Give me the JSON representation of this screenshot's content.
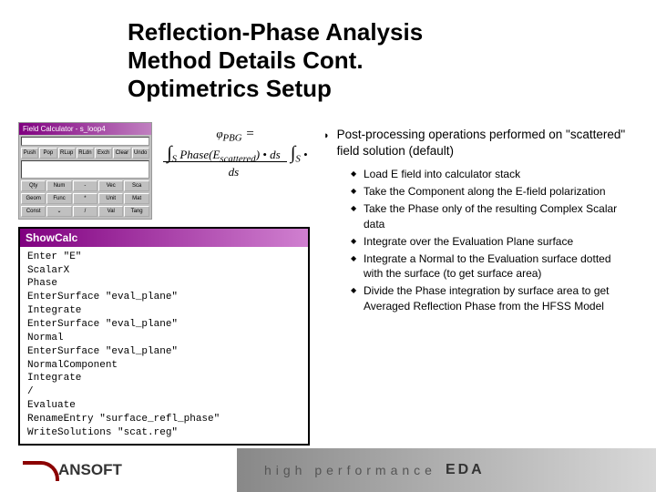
{
  "title_line1": "Reflection-Phase Analysis",
  "title_line2": "Method Details Cont.",
  "title_line3": "Optimetrics Setup",
  "calc_window": {
    "title": "Field Calculator - s_loop4"
  },
  "formula": {
    "label": "φ",
    "sub": "PBG",
    "eq": "=",
    "num_int": "∫",
    "num_sub": "S",
    "num_expr": "Phase(E",
    "num_expr_sub": "scattered",
    "num_expr2": ") • ds",
    "den_int": "∫",
    "den_sub": "S",
    "den_expr": "• ds"
  },
  "showcalc": {
    "title": "ShowCalc",
    "lines": [
      "Enter \"E\"",
      "ScalarX",
      "Phase",
      "EnterSurface \"eval_plane\"",
      "Integrate",
      "EnterSurface \"eval_plane\"",
      "Normal",
      "EnterSurface \"eval_plane\"",
      "NormalComponent",
      "Integrate",
      "/",
      "Evaluate",
      "RenameEntry \"surface_refl_phase\"",
      "WriteSolutions \"scat.reg\""
    ]
  },
  "main_point": "Post-processing operations performed on \"scattered\" field solution (default)",
  "sub_points": [
    "Load E field into calculator stack",
    "Take the Component along the E-field polarization",
    "Take the Phase only of the resulting Complex Scalar data",
    "Integrate over the Evaluation Plane surface",
    "Integrate a Normal to the Evaluation surface dotted with the surface (to get surface area)",
    "Divide the Phase integration by surface area to get Averaged Reflection Phase from the HFSS Model"
  ],
  "footer": {
    "logo": "ANSOFT",
    "tagline": "high performance",
    "tagline_bold": "EDA"
  },
  "calc_buttons_row1": [
    "Push",
    "Pop",
    "RLup",
    "RLdn",
    "Exch",
    "Clear",
    "Undo"
  ],
  "calc_buttons_row2": [
    "Qty",
    "Num",
    "-",
    "Vec",
    "Sca"
  ],
  "calc_buttons_row3": [
    "Geom",
    "Func",
    "*",
    "Unit",
    "Mat"
  ],
  "calc_buttons_row4": [
    "Const",
    "⌄",
    "/",
    "Val",
    "Tang"
  ]
}
